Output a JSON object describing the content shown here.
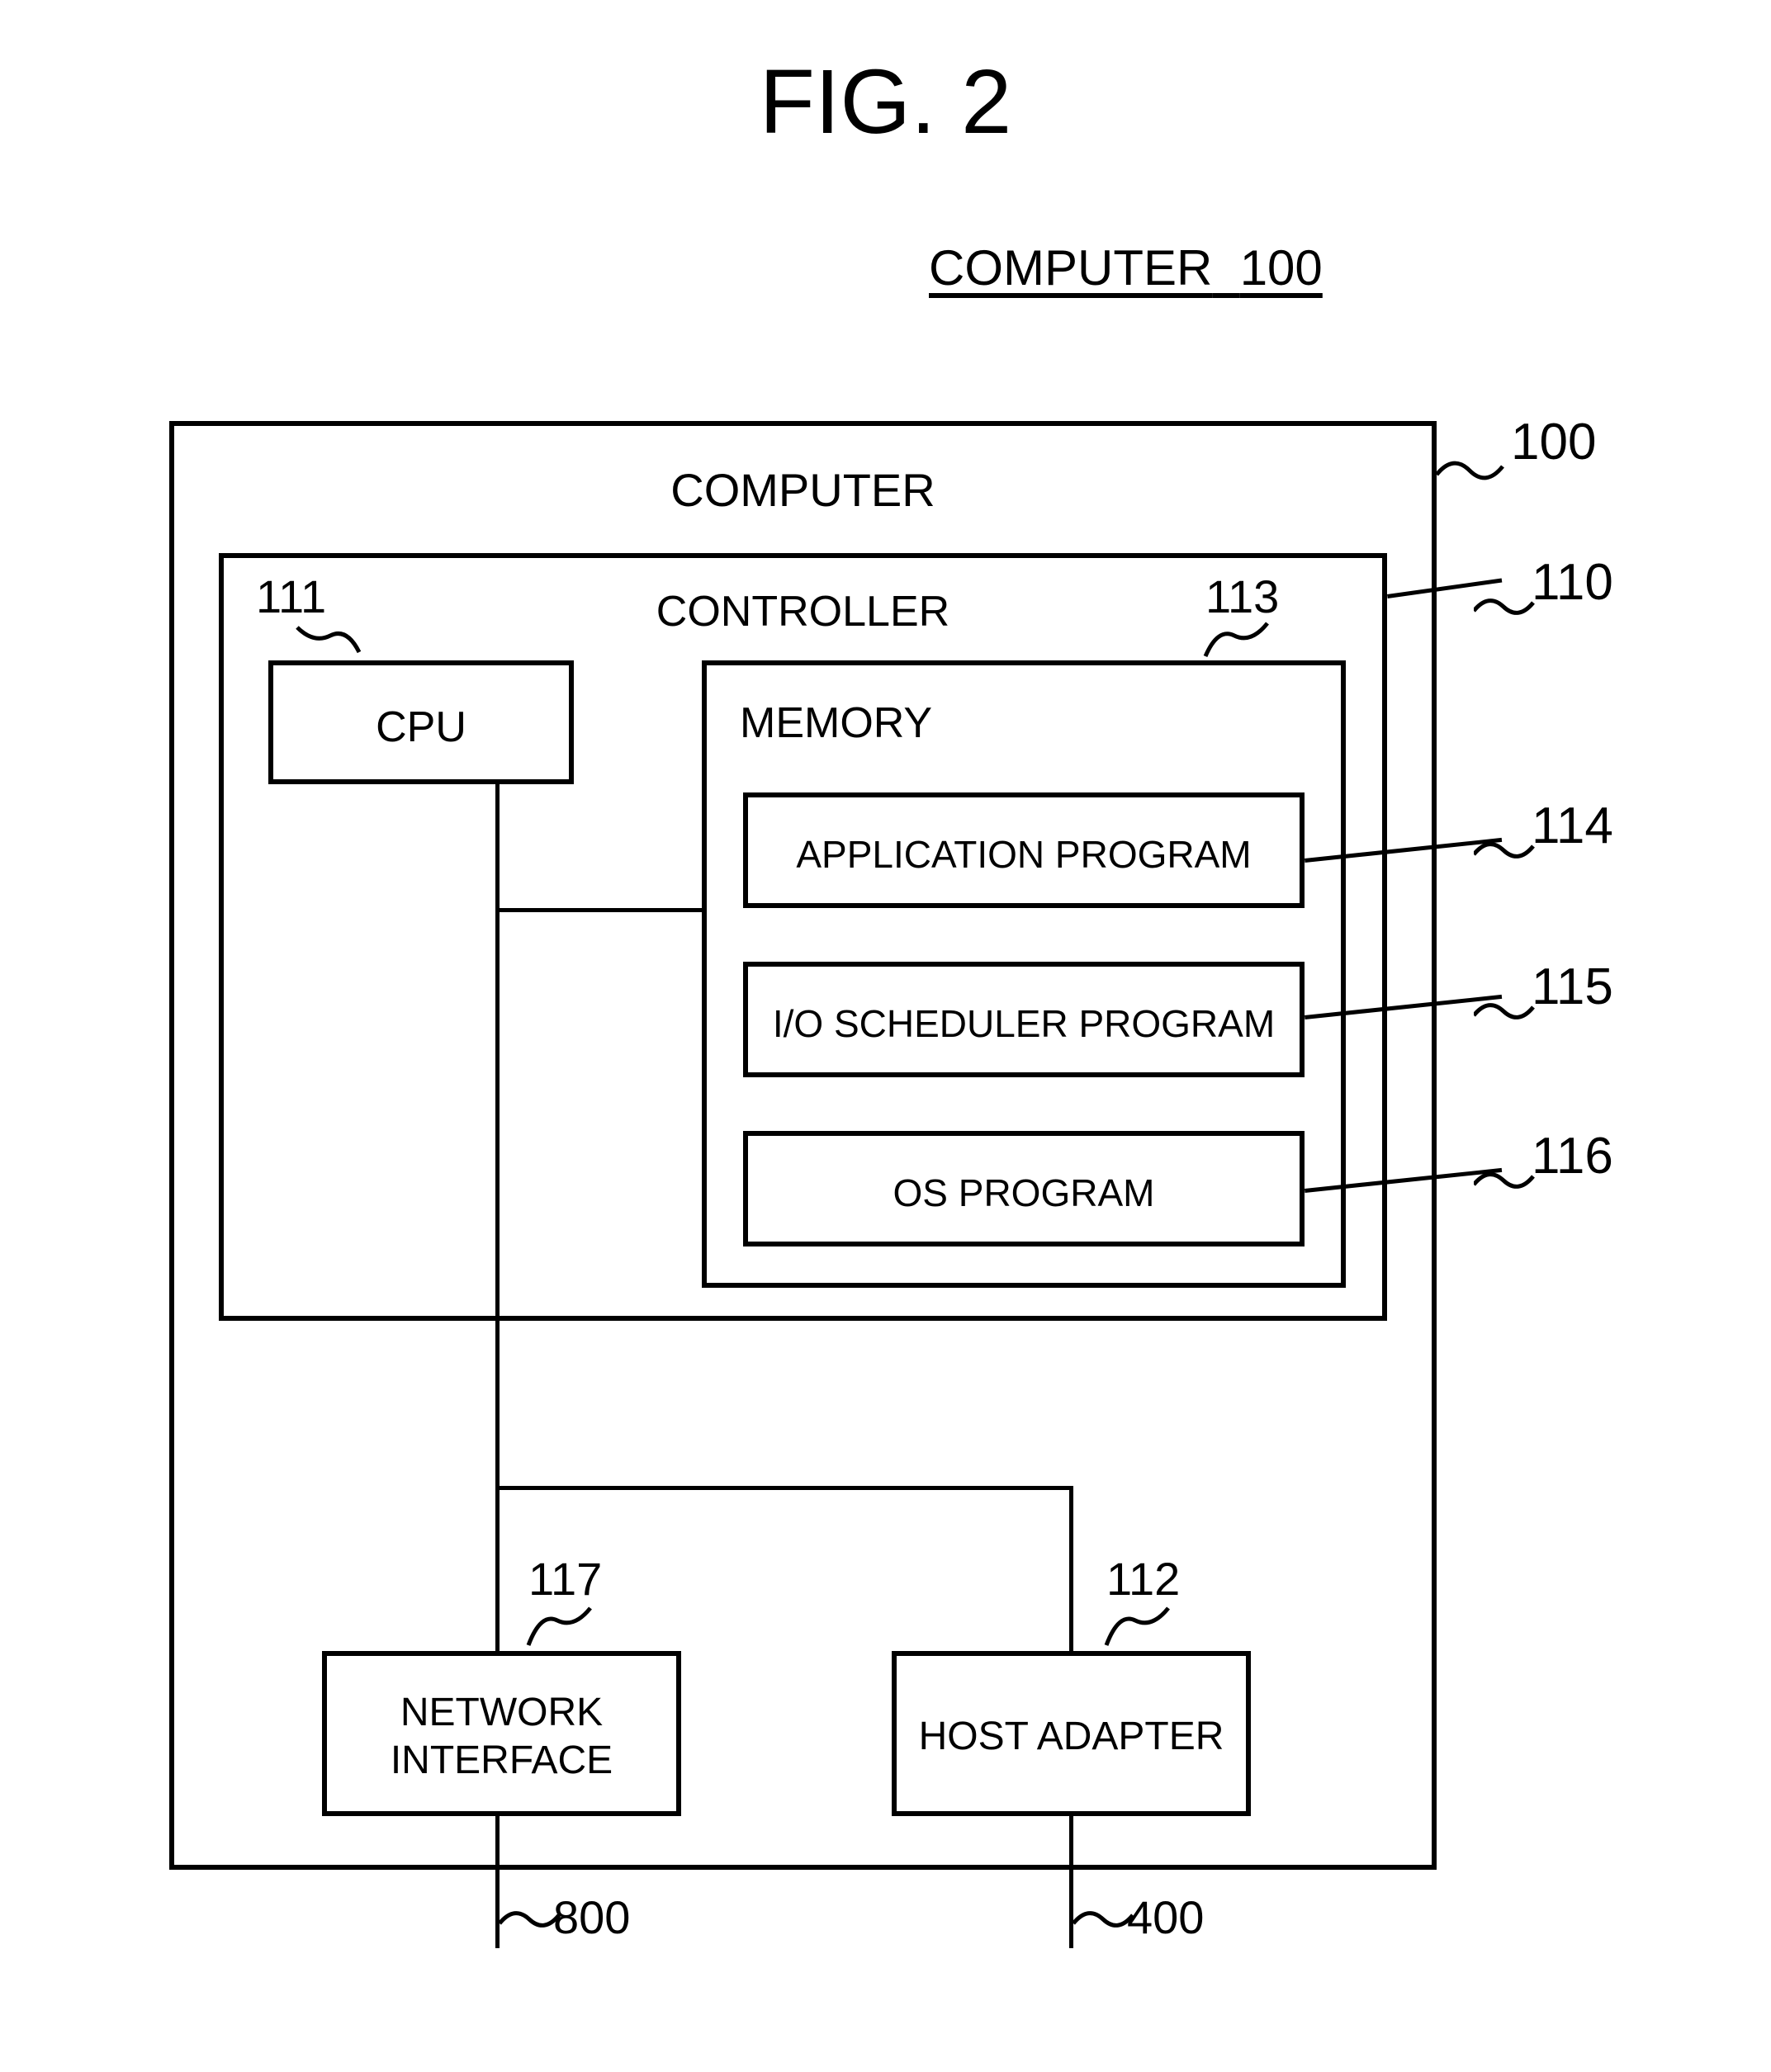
{
  "figure": {
    "title": "FIG. 2",
    "subtitle_prefix": "COMPUTER",
    "subtitle_ref": "100"
  },
  "blocks": {
    "computer": {
      "label": "COMPUTER",
      "ref": "100"
    },
    "controller": {
      "label": "CONTROLLER",
      "ref": "110"
    },
    "cpu": {
      "label": "CPU",
      "ref": "111"
    },
    "memory": {
      "label": "MEMORY",
      "ref": "113"
    },
    "app": {
      "label": "APPLICATION PROGRAM",
      "ref": "114"
    },
    "iosched": {
      "label": "I/O SCHEDULER PROGRAM",
      "ref": "115"
    },
    "os": {
      "label": "OS PROGRAM",
      "ref": "116"
    },
    "netif": {
      "label": "NETWORK INTERFACE",
      "ref": "117"
    },
    "hostadapter": {
      "label": "HOST ADAPTER",
      "ref": "112"
    },
    "conn_left": {
      "ref": "800"
    },
    "conn_right": {
      "ref": "400"
    }
  }
}
